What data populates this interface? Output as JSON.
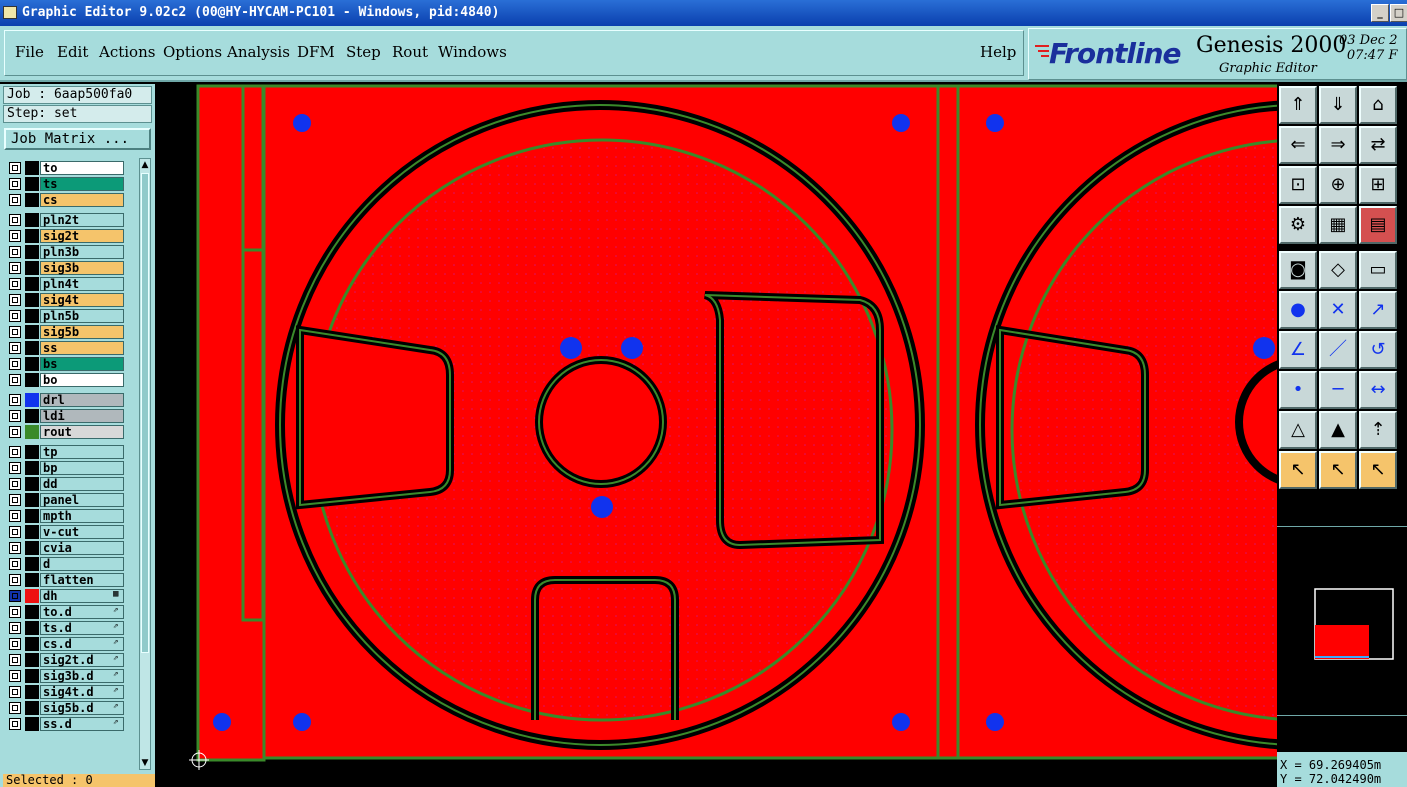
{
  "window": {
    "title": "Graphic Editor 9.02c2 (00@HY-HYCAM-PC101 - Windows, pid:4840)",
    "controls": [
      "_",
      "□"
    ]
  },
  "menu": {
    "items": [
      "File",
      "Edit",
      "Actions",
      "Options",
      "Analysis",
      "DFM",
      "Step",
      "Rout",
      "Windows"
    ],
    "help": "Help"
  },
  "brand": {
    "logo": "Frontline",
    "product": "Genesis 2000",
    "subtitle": "Graphic Editor",
    "date": "03 Dec 2",
    "time": "07:47 F"
  },
  "job": {
    "job": "Job : 6aap500fa0",
    "step": "Step: set",
    "matrix_button": "Job Matrix ..."
  },
  "layers": [
    {
      "name": "to",
      "color": "#ffffff",
      "swatch": "#000000"
    },
    {
      "name": "ts",
      "color": "#0c9a78",
      "swatch": "#000000"
    },
    {
      "name": "cs",
      "color": "#f5c46b",
      "swatch": "#000000"
    },
    {
      "name": "pln2t",
      "color": "#a6dcdc",
      "swatch": "#000000"
    },
    {
      "name": "sig2t",
      "color": "#f5c46b",
      "swatch": "#000000"
    },
    {
      "name": "pln3b",
      "color": "#a6dcdc",
      "swatch": "#000000"
    },
    {
      "name": "sig3b",
      "color": "#f5c46b",
      "swatch": "#000000"
    },
    {
      "name": "pln4t",
      "color": "#a6dcdc",
      "swatch": "#000000"
    },
    {
      "name": "sig4t",
      "color": "#f5c46b",
      "swatch": "#000000"
    },
    {
      "name": "pln5b",
      "color": "#a6dcdc",
      "swatch": "#000000"
    },
    {
      "name": "sig5b",
      "color": "#f5c46b",
      "swatch": "#000000"
    },
    {
      "name": "ss",
      "color": "#f5c46b",
      "swatch": "#000000"
    },
    {
      "name": "bs",
      "color": "#0c9a78",
      "swatch": "#000000"
    },
    {
      "name": "bo",
      "color": "#ffffff",
      "swatch": "#000000"
    },
    {
      "name": "drl",
      "color": "#b0b8bc",
      "swatch": "#1133ee"
    },
    {
      "name": "ldi",
      "color": "#b0b8bc",
      "swatch": "#000000"
    },
    {
      "name": "rout",
      "color": "#d8d8d8",
      "swatch": "#3a8a2a"
    },
    {
      "name": "tp",
      "color": "#a6dcdc",
      "swatch": "#000000"
    },
    {
      "name": "bp",
      "color": "#a6dcdc",
      "swatch": "#000000"
    },
    {
      "name": "dd",
      "color": "#a6dcdc",
      "swatch": "#000000"
    },
    {
      "name": "panel",
      "color": "#a6dcdc",
      "swatch": "#000000"
    },
    {
      "name": "mpth",
      "color": "#a6dcdc",
      "swatch": "#000000"
    },
    {
      "name": "v-cut",
      "color": "#a6dcdc",
      "swatch": "#000000"
    },
    {
      "name": "cvia",
      "color": "#a6dcdc",
      "swatch": "#000000"
    },
    {
      "name": "d",
      "color": "#a6dcdc",
      "swatch": "#000000"
    },
    {
      "name": "flatten",
      "color": "#a6dcdc",
      "swatch": "#000000"
    },
    {
      "name": "dh",
      "color": "#a6dcdc",
      "swatch": "#ee1111",
      "active": true,
      "mark": "▦"
    },
    {
      "name": "to.d",
      "color": "#a6dcdc",
      "swatch": "#000000",
      "mark": "⇗"
    },
    {
      "name": "ts.d",
      "color": "#a6dcdc",
      "swatch": "#000000",
      "mark": "⇗"
    },
    {
      "name": "cs.d",
      "color": "#a6dcdc",
      "swatch": "#000000",
      "mark": "⇗"
    },
    {
      "name": "sig2t.d",
      "color": "#a6dcdc",
      "swatch": "#000000",
      "mark": "⇗"
    },
    {
      "name": "sig3b.d",
      "color": "#a6dcdc",
      "swatch": "#000000",
      "mark": "⇗"
    },
    {
      "name": "sig4t.d",
      "color": "#a6dcdc",
      "swatch": "#000000",
      "mark": "⇗"
    },
    {
      "name": "sig5b.d",
      "color": "#a6dcdc",
      "swatch": "#000000",
      "mark": "⇗"
    },
    {
      "name": "ss.d",
      "color": "#a6dcdc",
      "swatch": "#000000",
      "mark": "⇗"
    }
  ],
  "status": {
    "selected": "Selected : 0",
    "x": "X = 69.269405m",
    "y": "Y = 72.042490m"
  },
  "tools": [
    "zoom-home-icon",
    "zoom-back-icon",
    "home-icon",
    "pan-left-icon",
    "pan-right-icon",
    "zoom-1-1-icon",
    "fit-all-icon",
    "fit-window-icon",
    "ratio-1-2-icon",
    "settings-icon",
    "grid-icon",
    "layer-stack-icon",
    "snap-icon",
    "measure-icon",
    "ruler-icon",
    "connect-icon",
    "intersect-icon",
    "line-point-icon",
    "angle-icon",
    "draw-line-icon",
    "rotate-icon",
    "point-icon",
    "minus-icon",
    "distance-icon",
    "triangle-icon",
    "triangle-up-icon",
    "triangle-arrow-icon",
    "select-icon",
    "select-box-icon",
    "select-shape-icon"
  ],
  "colors": {
    "copper": "#ff0000",
    "outline": "#3a8a2a",
    "pad": "#1133ee",
    "panel": "#a6dcdc"
  }
}
